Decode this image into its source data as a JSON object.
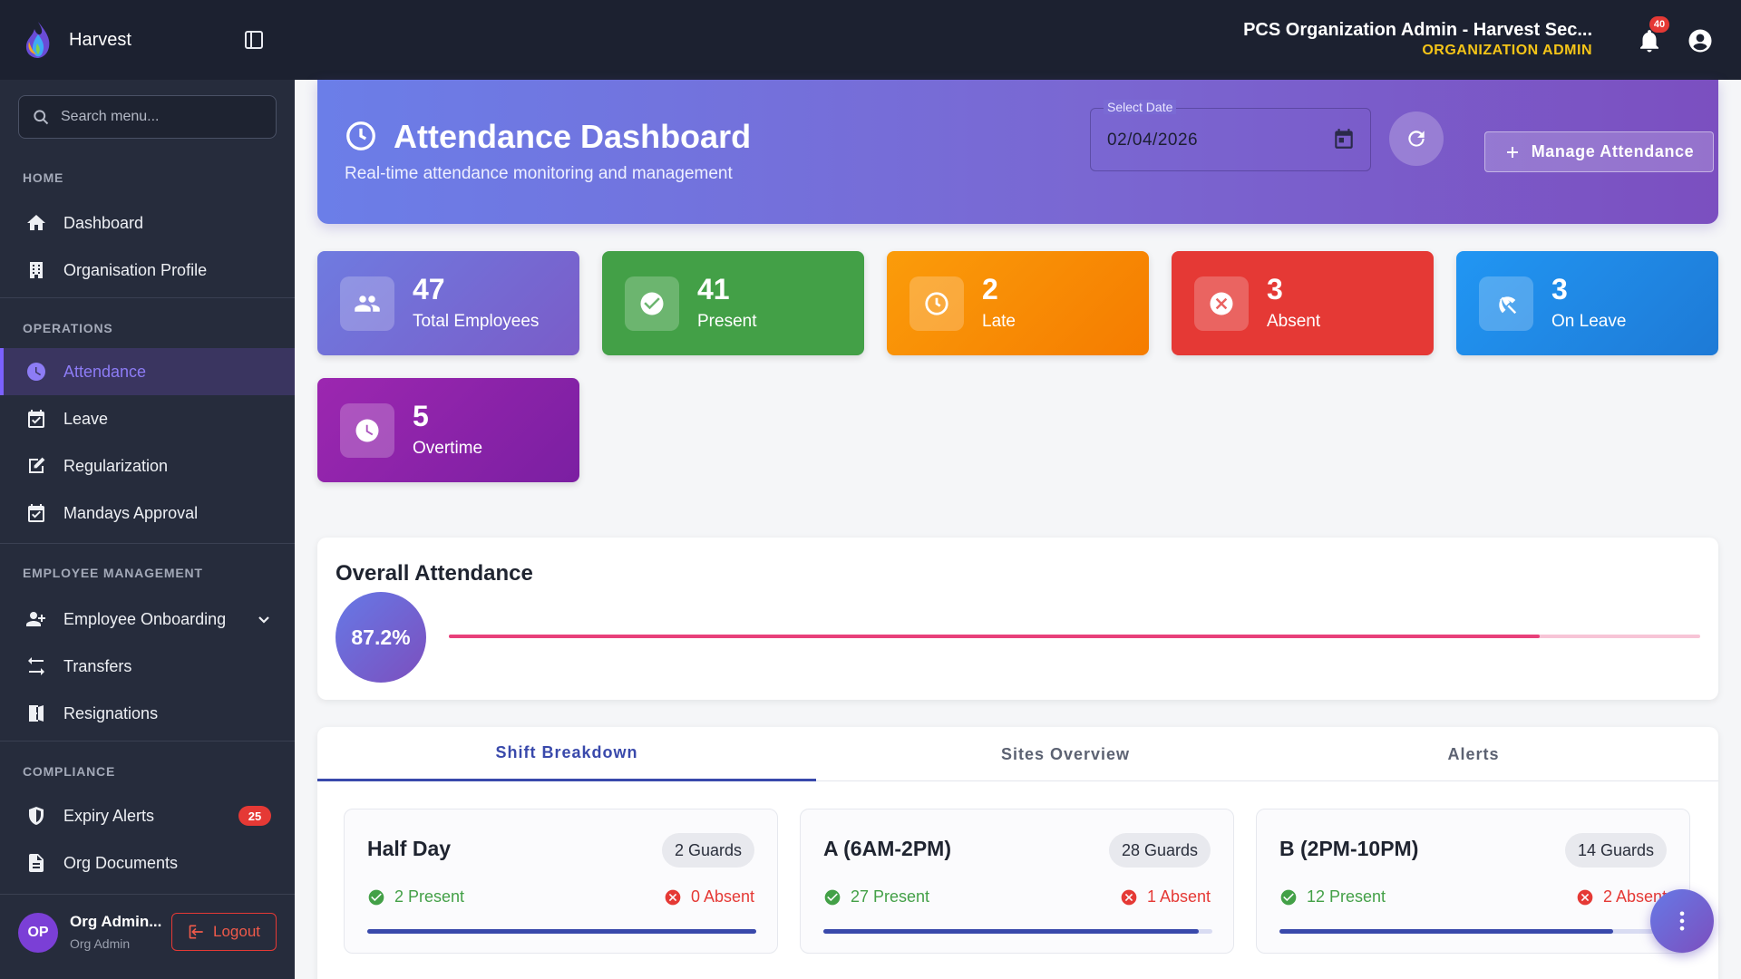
{
  "topbar": {
    "brand_name": "Harvest",
    "org_name": "PCS Organization Admin - Harvest Sec...",
    "org_role": "ORGANIZATION ADMIN",
    "notification_count": "40"
  },
  "sidebar": {
    "search_placeholder": "Search menu...",
    "sections": {
      "home": "HOME",
      "operations": "OPERATIONS",
      "employee_management": "EMPLOYEE MANAGEMENT",
      "compliance": "COMPLIANCE"
    },
    "items": {
      "dashboard": "Dashboard",
      "org_profile": "Organisation Profile",
      "attendance": "Attendance",
      "leave": "Leave",
      "regularization": "Regularization",
      "mandays": "Mandays Approval",
      "onboarding": "Employee Onboarding",
      "transfers": "Transfers",
      "resignations": "Resignations",
      "expiry_alerts": "Expiry Alerts",
      "expiry_alerts_badge": "25",
      "org_documents": "Org Documents"
    },
    "user": {
      "initials": "OP",
      "name": "Org Admin...",
      "role": "Org Admin",
      "logout_label": "Logout"
    }
  },
  "hero": {
    "title": "Attendance Dashboard",
    "subtitle": "Real-time attendance monitoring and management",
    "date_label": "Select Date",
    "date_value": "02/04/2026",
    "manage_label": "Manage Attendance"
  },
  "stats": [
    {
      "value": "47",
      "label": "Total Employees",
      "color": "#7676d8",
      "icon": "people-icon"
    },
    {
      "value": "41",
      "label": "Present",
      "color": "#43a047",
      "icon": "check-circle-icon"
    },
    {
      "value": "2",
      "label": "Late",
      "color": "#fb8c00",
      "icon": "clock-icon"
    },
    {
      "value": "3",
      "label": "Absent",
      "color": "#e53935",
      "icon": "cancel-icon"
    },
    {
      "value": "3",
      "label": "On Leave",
      "color": "#1e88e5",
      "icon": "beach-umbrella-icon"
    },
    {
      "value": "5",
      "label": "Overtime",
      "color": "#8e24aa",
      "icon": "clock-icon"
    }
  ],
  "overall": {
    "title": "Overall Attendance",
    "percent_label": "87.2%",
    "percent": 87.2
  },
  "tabs": [
    "Shift Breakdown",
    "Sites Overview",
    "Alerts"
  ],
  "shifts": [
    {
      "name": "Half Day",
      "guards": "2 Guards",
      "present": "2 Present",
      "absent": "0 Absent",
      "fill": 1.0
    },
    {
      "name": "A (6AM-2PM)",
      "guards": "28 Guards",
      "present": "27 Present",
      "absent": "1 Absent",
      "fill": 0.964
    },
    {
      "name": "B (2PM-10PM)",
      "guards": "14 Guards",
      "present": "12 Present",
      "absent": "2 Absent",
      "fill": 0.857
    }
  ]
}
